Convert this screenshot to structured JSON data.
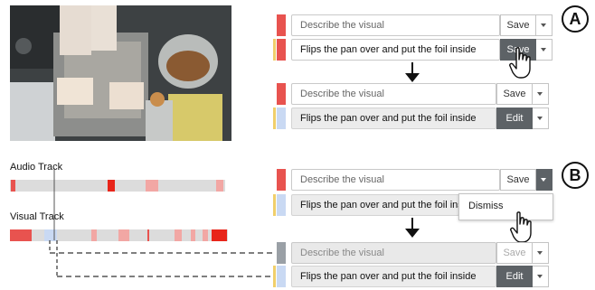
{
  "tracks": {
    "audio_label": "Audio Track",
    "visual_label": "Visual Track"
  },
  "panel_a": {
    "badge": "A",
    "row1": {
      "placeholder": "Describe the visual",
      "save": "Save"
    },
    "row2": {
      "text": "Flips the pan over and put the foil inside",
      "save": "Save"
    },
    "row3": {
      "placeholder": "Describe the visual",
      "save": "Save"
    },
    "row4": {
      "text": "Flips the pan over and put the foil inside",
      "edit": "Edit"
    }
  },
  "panel_b": {
    "badge": "B",
    "row1": {
      "placeholder": "Describe the visual",
      "save": "Save"
    },
    "row2": {
      "text": "Flips the pan over and put the foil inside"
    },
    "menu": {
      "dismiss": "Dismiss"
    },
    "row3": {
      "placeholder": "Describe the visual",
      "save": "Save"
    },
    "row4": {
      "text": "Flips the pan over and put the foil inside",
      "edit": "Edit"
    }
  },
  "colors": {
    "red": "#e8534f",
    "light_red": "#f2a7a4",
    "bright_red": "#e8251a",
    "yellow": "#f0cf6b",
    "light_blue": "#c9d9f3",
    "grey_strip": "#9aa0a6",
    "button_dark": "#5d6266"
  },
  "icons": [
    "arrow-down-icon",
    "hand-cursor-icon",
    "caret-down-icon"
  ]
}
